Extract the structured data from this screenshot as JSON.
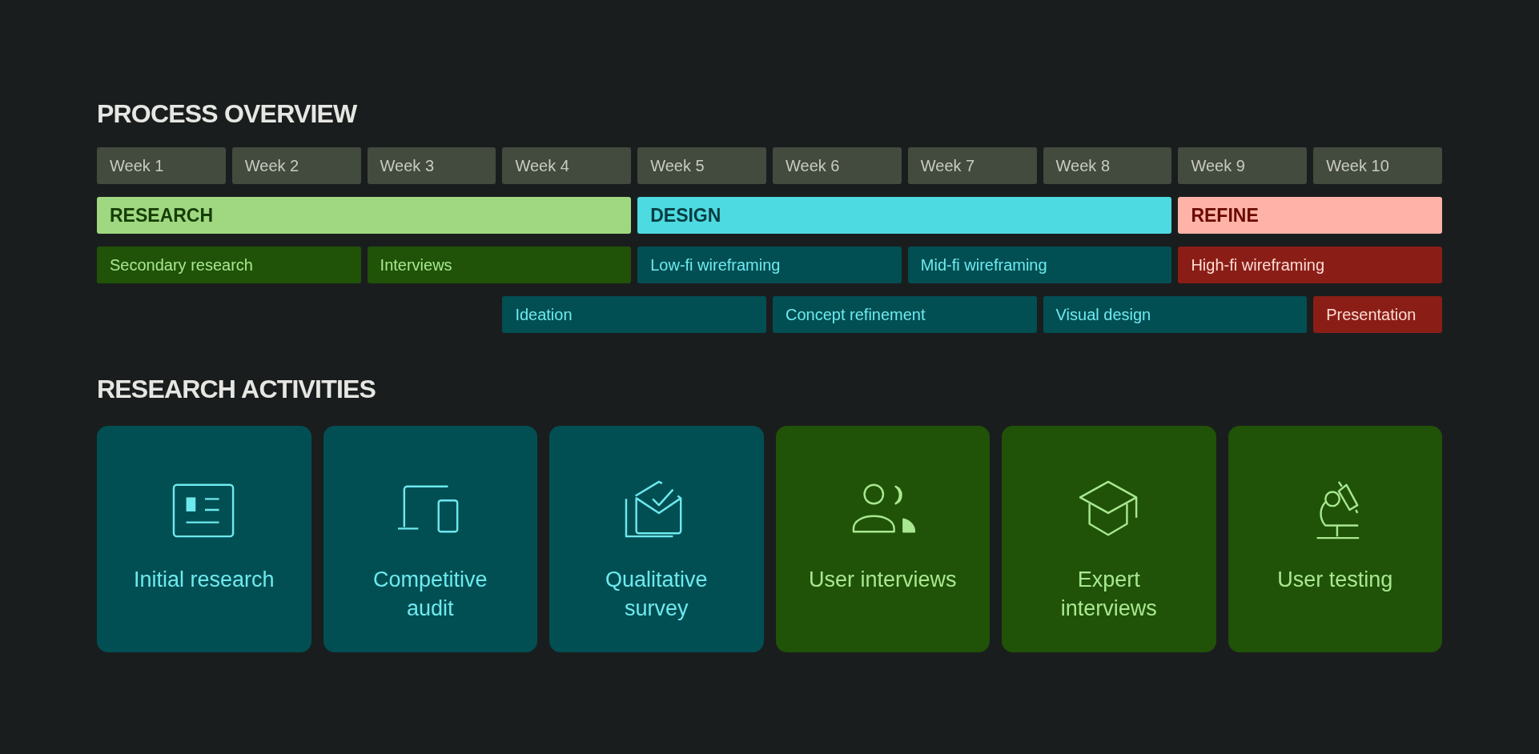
{
  "process_overview": {
    "title": "PROCESS OVERVIEW",
    "weeks": [
      "Week 1",
      "Week 2",
      "Week 3",
      "Week 4",
      "Week 5",
      "Week 6",
      "Week 7",
      "Week 8",
      "Week 9",
      "Week 10"
    ],
    "phases": [
      {
        "label": "RESEARCH",
        "kind": "research"
      },
      {
        "label": "DESIGN",
        "kind": "design"
      },
      {
        "label": "REFINE",
        "kind": "refine"
      }
    ],
    "activity_rows": [
      [
        {
          "label": "Secondary research",
          "kind": "research"
        },
        {
          "label": "Interviews",
          "kind": "research"
        },
        {
          "label": "Low-fi wireframing",
          "kind": "design"
        },
        {
          "label": "Mid-fi wireframing",
          "kind": "design"
        },
        {
          "label": "High-fi wireframing",
          "kind": "refine"
        }
      ],
      [
        {
          "label": "Ideation",
          "kind": "design"
        },
        {
          "label": "Concept refinement",
          "kind": "design"
        },
        {
          "label": "Visual design",
          "kind": "design"
        },
        {
          "label": "Presentation",
          "kind": "refine"
        }
      ]
    ]
  },
  "research_activities": {
    "title": "RESEARCH ACTIVITIES",
    "cards": [
      {
        "label": "Initial research",
        "kind": "desk"
      },
      {
        "label": "Competitive audit",
        "kind": "desk"
      },
      {
        "label": "Qualitative survey",
        "kind": "desk"
      },
      {
        "label": "User interviews",
        "kind": "field"
      },
      {
        "label": "Expert interviews",
        "kind": "field"
      },
      {
        "label": "User testing",
        "kind": "field"
      }
    ]
  }
}
